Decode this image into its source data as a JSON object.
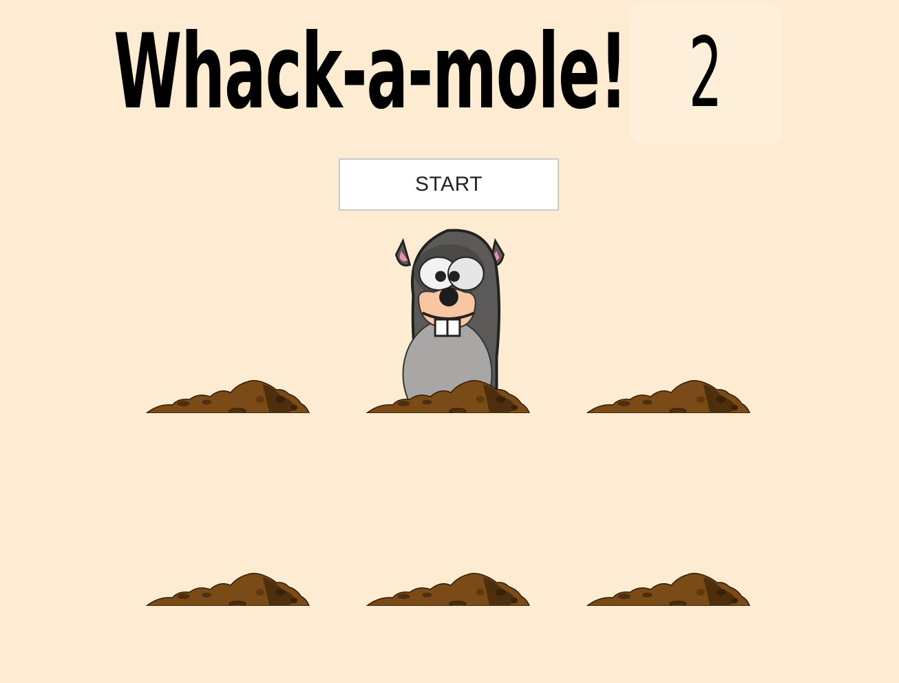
{
  "game": {
    "title": "Whack-a-mole!",
    "score": "2",
    "start_label": "START"
  },
  "holes": [
    {
      "id": 1,
      "mole_visible": false
    },
    {
      "id": 2,
      "mole_visible": true
    },
    {
      "id": 3,
      "mole_visible": false
    },
    {
      "id": 4,
      "mole_visible": false
    },
    {
      "id": 5,
      "mole_visible": false
    },
    {
      "id": 6,
      "mole_visible": false
    }
  ],
  "colors": {
    "background": "#fdecd1",
    "score_box": "#feefdb",
    "dirt": "#7a4a17",
    "dirt_dark": "#4e2f0d",
    "mole_body": "#5b5a58",
    "mole_belly": "#a9a6a6",
    "mole_snout": "#f8c6a0",
    "mole_ear": "#f08cae"
  }
}
